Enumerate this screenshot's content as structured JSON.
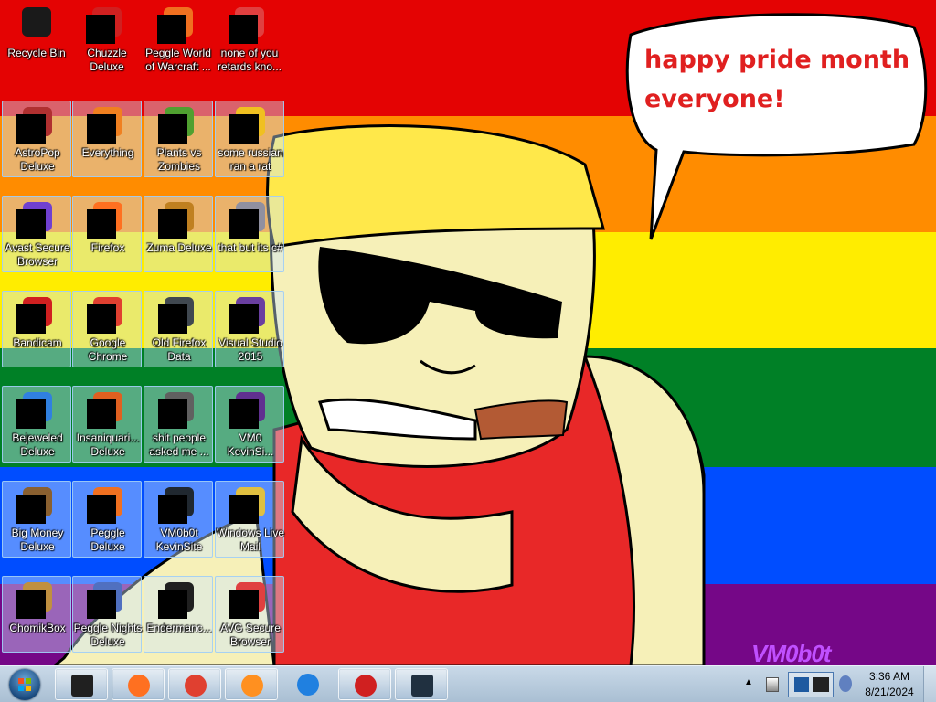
{
  "wallpaper": {
    "stripe_colors": [
      "#e40303",
      "#ff8c00",
      "#ffed00",
      "#008026",
      "#004dff",
      "#750787"
    ],
    "speech_text_line1": "happy pride month",
    "speech_text_line2": "everyone!",
    "speech_color": "#e02020",
    "signature": "VM0b0t",
    "signature_color": "#c050ff"
  },
  "desktop": {
    "icons": [
      {
        "label": "Recycle Bin",
        "color": "#1a1a1a",
        "icon": "recycle-bin-icon"
      },
      {
        "label": "Chuzzle Deluxe",
        "color": "#d02020",
        "icon": "chuzzle-icon"
      },
      {
        "label": "Peggle World of Warcraft ...",
        "color": "#f07020",
        "icon": "peggle-wow-icon"
      },
      {
        "label": "none of you retards kno...",
        "color": "#e04040",
        "icon": "shortcut-icon"
      },
      {
        "label": "AstroPop Deluxe",
        "color": "#b03030",
        "icon": "astropop-icon"
      },
      {
        "label": "Everything",
        "color": "#f08020",
        "icon": "everything-search-icon"
      },
      {
        "label": "Plants vs Zombies",
        "color": "#50a030",
        "icon": "plants-vs-zombies-icon"
      },
      {
        "label": "some russian ran a rat",
        "color": "#f0c020",
        "icon": "file-icon"
      },
      {
        "label": "Avast Secure Browser",
        "color": "#7040d0",
        "icon": "avast-browser-icon"
      },
      {
        "label": "Firefox",
        "color": "#ff7020",
        "icon": "firefox-icon"
      },
      {
        "label": "Zuma Deluxe",
        "color": "#c08020",
        "icon": "zuma-icon"
      },
      {
        "label": "that but its c#",
        "color": "#9090a0",
        "icon": "shortcut-icon"
      },
      {
        "label": "Bandicam",
        "color": "#d02020",
        "icon": "bandicam-icon"
      },
      {
        "label": "Google Chrome",
        "color": "#e04030",
        "icon": "chrome-icon"
      },
      {
        "label": "Old Firefox Data",
        "color": "#404850",
        "icon": "folder-icon"
      },
      {
        "label": "Visual Studio 2015",
        "color": "#6a3fa0",
        "icon": "visual-studio-icon"
      },
      {
        "label": "Bejeweled Deluxe",
        "color": "#3080e0",
        "icon": "bejeweled-icon"
      },
      {
        "label": "Insaniquari... Deluxe",
        "color": "#e06020",
        "icon": "insaniquarium-icon"
      },
      {
        "label": "shit people asked me ...",
        "color": "#606060",
        "icon": "folder-icon"
      },
      {
        "label": "VM0 KevinSi...",
        "color": "#603090",
        "icon": "file-icon"
      },
      {
        "label": "Big Money Deluxe",
        "color": "#8a6030",
        "icon": "big-money-icon"
      },
      {
        "label": "Peggle Deluxe",
        "color": "#f07020",
        "icon": "peggle-icon"
      },
      {
        "label": "VM0b0t KevinSite",
        "color": "#202830",
        "icon": "file-icon"
      },
      {
        "label": "Windows Live Mail",
        "color": "#e0c040",
        "icon": "mail-icon"
      },
      {
        "label": "ChomikBox",
        "color": "#c09040",
        "icon": "chomikbox-icon"
      },
      {
        "label": "Peggle Nights Deluxe",
        "color": "#5070c0",
        "icon": "peggle-nights-icon"
      },
      {
        "label": "Endermanc...",
        "color": "#202020",
        "icon": "file-icon"
      },
      {
        "label": "AVG Secure Browser",
        "color": "#e04040",
        "icon": "avg-browser-icon"
      }
    ]
  },
  "taskbar": {
    "pinned": [
      {
        "icon": "media-center-icon",
        "color": "#202020"
      },
      {
        "icon": "firefox-icon",
        "color": "#ff7020"
      },
      {
        "icon": "chrome-icon",
        "color": "#e04030"
      },
      {
        "icon": "avast-browser-icon",
        "color": "#ff9020"
      },
      {
        "icon": "avg-browser-icon",
        "color": "#2080e0"
      },
      {
        "icon": "bandicam-icon",
        "color": "#d02020"
      },
      {
        "icon": "task-manager-icon",
        "color": "#203040"
      }
    ],
    "clock": {
      "time": "3:36 AM",
      "date": "8/21/2024"
    }
  }
}
